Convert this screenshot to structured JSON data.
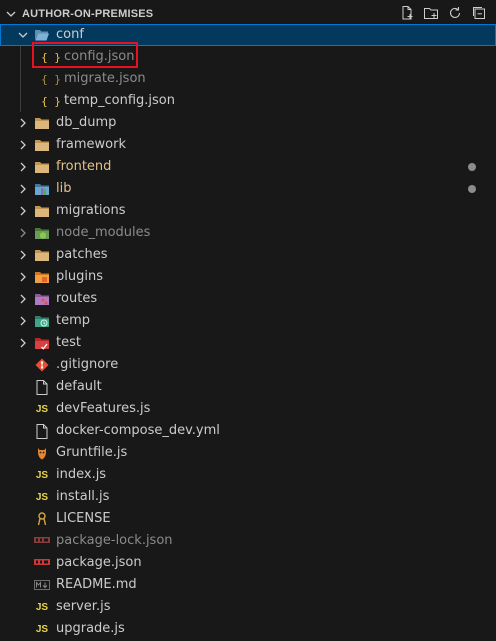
{
  "explorer": {
    "title": "AUTHOR-ON-PREMISES",
    "actions": [
      "new-file-icon",
      "new-folder-icon",
      "refresh-icon",
      "collapse-all-icon"
    ]
  },
  "tree": [
    {
      "label": "conf",
      "kind": "folder",
      "expanded": true,
      "selected": true,
      "icon": "folder-open-icon"
    },
    {
      "label": "config.json",
      "kind": "file",
      "icon": "json-braces-icon",
      "dim": true,
      "highlighted": true
    },
    {
      "label": "migrate.json",
      "kind": "file",
      "icon": "json-braces-icon",
      "dim": true
    },
    {
      "label": "temp_config.json",
      "kind": "file",
      "icon": "json-braces-icon"
    },
    {
      "label": "db_dump",
      "kind": "folder",
      "icon": "folder-icon"
    },
    {
      "label": "framework",
      "kind": "folder",
      "icon": "folder-icon"
    },
    {
      "label": "frontend",
      "kind": "folder",
      "icon": "folder-icon",
      "color": "#e2c08d",
      "modified": true
    },
    {
      "label": "lib",
      "kind": "folder",
      "icon": "folder-lib-icon",
      "color": "#e2c08d",
      "modified": true
    },
    {
      "label": "migrations",
      "kind": "folder",
      "icon": "folder-icon"
    },
    {
      "label": "node_modules",
      "kind": "folder",
      "icon": "folder-node-icon",
      "dim": true
    },
    {
      "label": "patches",
      "kind": "folder",
      "icon": "folder-icon"
    },
    {
      "label": "plugins",
      "kind": "folder",
      "icon": "folder-plugins-icon"
    },
    {
      "label": "routes",
      "kind": "folder",
      "icon": "folder-routes-icon"
    },
    {
      "label": "temp",
      "kind": "folder",
      "icon": "folder-temp-icon"
    },
    {
      "label": "test",
      "kind": "folder",
      "icon": "folder-test-icon"
    },
    {
      "label": ".gitignore",
      "kind": "file",
      "icon": "git-icon"
    },
    {
      "label": "default",
      "kind": "file",
      "icon": "file-icon"
    },
    {
      "label": "devFeatures.js",
      "kind": "file",
      "icon": "javascript-icon"
    },
    {
      "label": "docker-compose_dev.yml",
      "kind": "file",
      "icon": "file-icon"
    },
    {
      "label": "Gruntfile.js",
      "kind": "file",
      "icon": "grunt-icon"
    },
    {
      "label": "index.js",
      "kind": "file",
      "icon": "javascript-icon"
    },
    {
      "label": "install.js",
      "kind": "file",
      "icon": "javascript-icon"
    },
    {
      "label": "LICENSE",
      "kind": "file",
      "icon": "license-icon"
    },
    {
      "label": "package-lock.json",
      "kind": "file",
      "icon": "npm-icon",
      "dim": true
    },
    {
      "label": "package.json",
      "kind": "file",
      "icon": "npm-icon"
    },
    {
      "label": "README.md",
      "kind": "file",
      "icon": "markdown-icon"
    },
    {
      "label": "server.js",
      "kind": "file",
      "icon": "javascript-icon"
    },
    {
      "label": "upgrade.js",
      "kind": "file",
      "icon": "javascript-icon"
    }
  ]
}
